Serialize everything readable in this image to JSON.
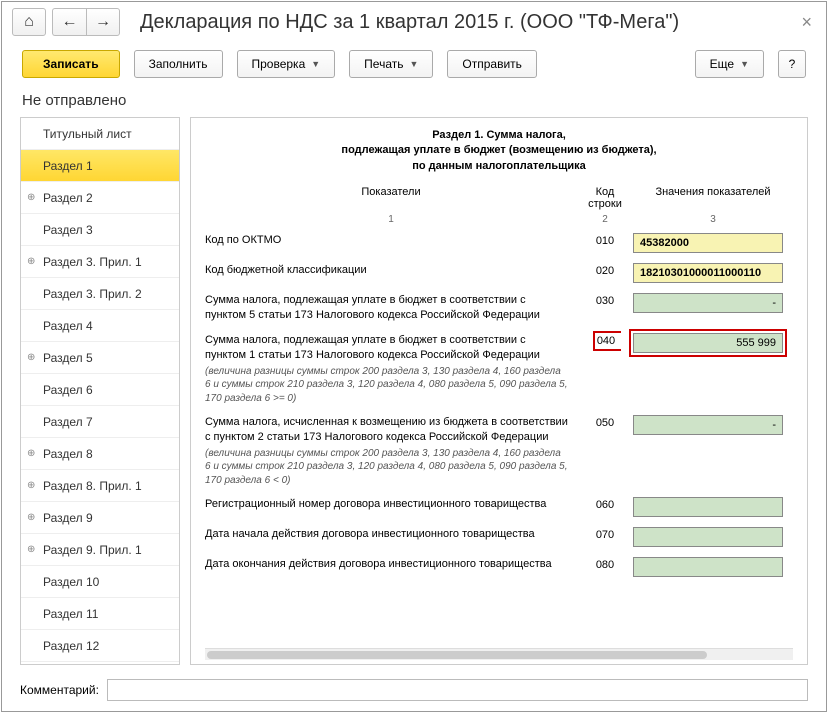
{
  "title": "Декларация по НДС за 1 квартал 2015 г. (ООО \"ТФ-Мега\")",
  "toolbar": {
    "record": "Записать",
    "fill": "Заполнить",
    "check": "Проверка",
    "print": "Печать",
    "send": "Отправить",
    "more": "Еще",
    "help": "?"
  },
  "status": "Не отправлено",
  "sidebar": [
    {
      "label": "Титульный лист",
      "expand": false
    },
    {
      "label": "Раздел 1",
      "expand": false,
      "active": true
    },
    {
      "label": "Раздел 2",
      "expand": true
    },
    {
      "label": "Раздел 3",
      "expand": false
    },
    {
      "label": "Раздел 3. Прил. 1",
      "expand": true
    },
    {
      "label": "Раздел 3. Прил. 2",
      "expand": false
    },
    {
      "label": "Раздел 4",
      "expand": false
    },
    {
      "label": "Раздел 5",
      "expand": true
    },
    {
      "label": "Раздел 6",
      "expand": false
    },
    {
      "label": "Раздел 7",
      "expand": false
    },
    {
      "label": "Раздел 8",
      "expand": true
    },
    {
      "label": "Раздел 8. Прил. 1",
      "expand": true
    },
    {
      "label": "Раздел 9",
      "expand": true
    },
    {
      "label": "Раздел 9. Прил. 1",
      "expand": true
    },
    {
      "label": "Раздел 10",
      "expand": false
    },
    {
      "label": "Раздел 11",
      "expand": false
    },
    {
      "label": "Раздел 12",
      "expand": false
    }
  ],
  "section": {
    "heading_l1": "Раздел 1. Сумма налога,",
    "heading_l2": "подлежащая уплате в бюджет (возмещению из бюджета),",
    "heading_l3": "по данным налогоплательщика",
    "col_ind": "Показатели",
    "col_code_l1": "Код",
    "col_code_l2": "строки",
    "col_val": "Значения показателей",
    "sub1": "1",
    "sub2": "2",
    "sub3": "3"
  },
  "rows": [
    {
      "label": "Код по ОКТМО",
      "code": "010",
      "value": "45382000",
      "style": "yellow"
    },
    {
      "label": "Код бюджетной классификации",
      "code": "020",
      "value": "18210301000011000110",
      "style": "yellow"
    },
    {
      "label": "Сумма налога, подлежащая уплате в бюджет в соответствии с пунктом 5 статьи 173 Налогового кодекса Российской Федерации",
      "code": "030",
      "value": "",
      "style": "dash"
    },
    {
      "label": "Сумма налога, подлежащая уплате в бюджет в соответствии с пунктом 1 статьи 173 Налогового кодекса Российской Федерации",
      "note": "(величина разницы суммы строк 200 раздела 3, 130 раздела 4, 160 раздела 6 и суммы строк 210 раздела 3, 120 раздела 4, 080 раздела 5, 090 раздела 5, 170 раздела 6 >= 0)",
      "code": "040",
      "value": "555 999",
      "style": "green",
      "highlight": true
    },
    {
      "label": "Сумма налога, исчисленная к возмещению из бюджета в соответствии с пунктом 2 статьи 173 Налогового кодекса Российской Федерации",
      "note": "(величина разницы суммы строк 200 раздела 3, 130 раздела 4, 160 раздела 6 и суммы строк 210 раздела 3, 120 раздела 4, 080 раздела 5, 090 раздела 5, 170 раздела 6 < 0)",
      "code": "050",
      "value": "",
      "style": "dash"
    },
    {
      "label": "Регистрационный номер договора инвестиционного товарищества",
      "code": "060",
      "value": "",
      "style": "green"
    },
    {
      "label": "Дата начала действия договора инвестиционного товарищества",
      "code": "070",
      "value": "",
      "style": "green"
    },
    {
      "label": "Дата окончания действия договора инвестиционного товарищества",
      "code": "080",
      "value": "",
      "style": "green"
    }
  ],
  "footer": {
    "label": "Комментарий:",
    "value": ""
  }
}
